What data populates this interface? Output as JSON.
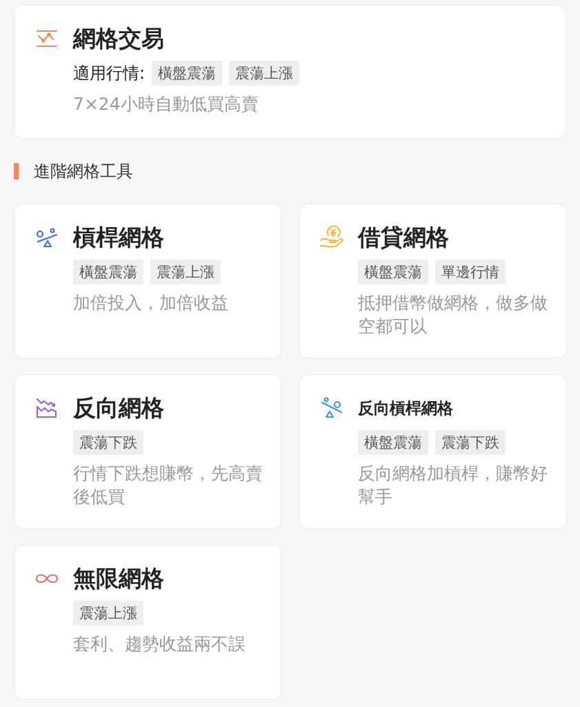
{
  "main_card": {
    "kind": "grid",
    "title": "網格交易",
    "market_label": "適用行情:",
    "tags": [
      "橫盤震蕩",
      "震蕩上漲"
    ],
    "description": "7×24小時自動低買高賣"
  },
  "section": {
    "title": "進階網格工具"
  },
  "cards": [
    {
      "kind": "lever",
      "title": "槓桿網格",
      "small_title": false,
      "tags": [
        "橫盤震蕩",
        "震蕩上漲"
      ],
      "description": "加倍投入，加倍收益"
    },
    {
      "kind": "loan",
      "title": "借貸網格",
      "small_title": false,
      "tags": [
        "橫盤震蕩",
        "單邊行情"
      ],
      "description": "抵押借幣做網格，做多做空都可以"
    },
    {
      "kind": "down",
      "title": "反向網格",
      "small_title": false,
      "tags": [
        "震蕩下跌"
      ],
      "description": "行情下跌想賺幣，先高賣後低買"
    },
    {
      "kind": "reverse_lever",
      "title": "反向槓桿網格",
      "small_title": true,
      "tags": [
        "橫盤震蕩",
        "震蕩下跌"
      ],
      "description": "反向網格加槓桿，賺幣好幫手"
    },
    {
      "kind": "infinite",
      "title": "無限網格",
      "small_title": false,
      "tags": [
        "震蕩上漲"
      ],
      "description": "套利、趨勢收益兩不誤"
    }
  ]
}
